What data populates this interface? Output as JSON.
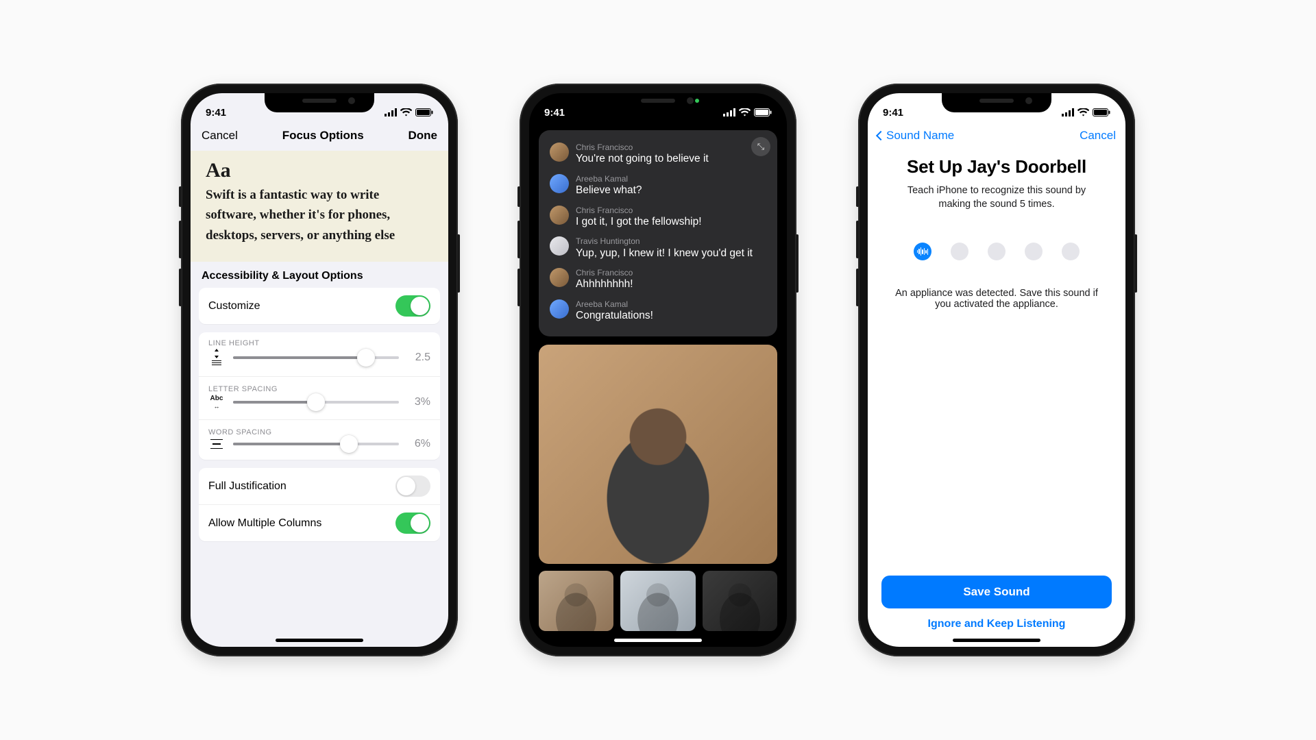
{
  "statusbar": {
    "time": "9:41"
  },
  "phone1": {
    "nav": {
      "cancel": "Cancel",
      "title": "Focus Options",
      "done": "Done"
    },
    "preview": {
      "aa": "Aa",
      "text": "Swift is a fantastic way to write software, whether it's for phones, desktops, servers, or anything else"
    },
    "section_title": "Accessibility & Layout Options",
    "customize_label": "Customize",
    "customize_on": true,
    "sliders": {
      "line_height": {
        "head": "LINE HEIGHT",
        "value": "2.5",
        "pct": 80
      },
      "letter_spacing": {
        "head": "LETTER SPACING",
        "value": "3%",
        "pct": 50,
        "lead": "Abc"
      },
      "word_spacing": {
        "head": "WORD SPACING",
        "value": "6%",
        "pct": 70
      }
    },
    "full_justification_label": "Full Justification",
    "full_justification_on": false,
    "multi_columns_label": "Allow Multiple Columns",
    "multi_columns_on": true
  },
  "phone2": {
    "captions": [
      {
        "name": "Chris Francisco",
        "msg": "You're not going to believe it",
        "av": "av-a"
      },
      {
        "name": "Areeba Kamal",
        "msg": "Believe what?",
        "av": "av-b"
      },
      {
        "name": "Chris Francisco",
        "msg": "I got it, I got the fellowship!",
        "av": "av-a"
      },
      {
        "name": "Travis Huntington",
        "msg": "Yup, yup, I knew it! I knew you'd get it",
        "av": "av-c"
      },
      {
        "name": "Chris Francisco",
        "msg": "Ahhhhhhhh!",
        "av": "av-a"
      },
      {
        "name": "Areeba Kamal",
        "msg": "Congratulations!",
        "av": "av-b"
      }
    ],
    "thumb_bgs": [
      "linear-gradient(135deg,#bca58a,#8f7357)",
      "linear-gradient(135deg,#cfd6dc,#9aa4ad)",
      "linear-gradient(135deg,#3b3b3b,#1e1e1e)"
    ]
  },
  "phone3": {
    "nav": {
      "back": "Sound Name",
      "cancel": "Cancel"
    },
    "title": "Set Up Jay's Doorbell",
    "subtitle": "Teach iPhone to recognize this sound by making the sound 5 times.",
    "hint": "An appliance was detected. Save this sound if you activated the appliance.",
    "primary": "Save Sound",
    "secondary": "Ignore and Keep Listening",
    "progress": {
      "total": 5,
      "filled": 1
    }
  }
}
